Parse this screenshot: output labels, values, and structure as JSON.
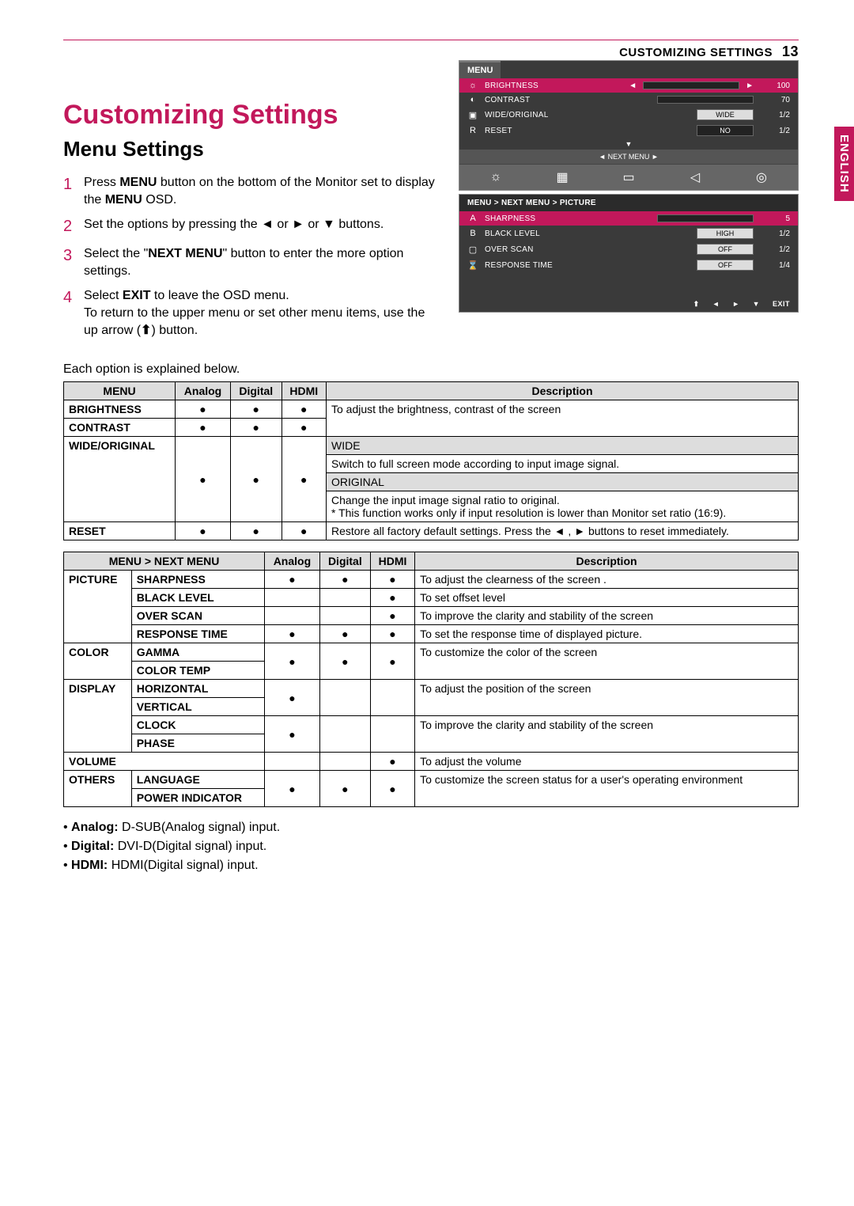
{
  "header": {
    "title": "CUSTOMIZING SETTINGS",
    "page": "13",
    "side_tab": "ENGLISH"
  },
  "h1": "Customizing Settings",
  "h2": "Menu Settings",
  "steps": {
    "s1a": "Press ",
    "s1b": "MENU",
    "s1c": " button on the bottom of the Monitor set to display the ",
    "s1d": "MENU",
    "s1e": " OSD.",
    "s2a": "Set the options by pressing the ",
    "s2b": "◄ or ► or ▼ ",
    "s2c": "buttons.",
    "s3a": "Select the \"",
    "s3b": "NEXT MENU",
    "s3c": "\" button to enter the more option settings.",
    "s4a": "Select ",
    "s4b": "EXIT",
    "s4c": " to leave the OSD menu.",
    "s4d": "To return to the upper menu or set other menu items, use the up arrow (",
    "s4e": ") button."
  },
  "osd1": {
    "tab": "MENU",
    "rows": [
      {
        "icn": "☼",
        "lbl": "BRIGHTNESS",
        "slider_pct": 100,
        "val": "100",
        "sel": true
      },
      {
        "icn": "◐",
        "lbl": "CONTRAST",
        "slider_pct": 70,
        "val": "70"
      },
      {
        "icn": "▣",
        "lbl": "WIDE/ORIGINAL",
        "pill": "WIDE",
        "pill_light": true,
        "val": "1/2"
      },
      {
        "icn": "R",
        "lbl": "RESET",
        "pill": "NO",
        "val": "1/2"
      }
    ],
    "nav": "◄   NEXT MENU   ►",
    "icons": [
      "☼",
      "▦",
      "▭",
      "◁",
      "◎"
    ]
  },
  "osd2": {
    "bc": "MENU  >  NEXT MENU  >  PICTURE",
    "rows": [
      {
        "icn": "A",
        "lbl": "SHARPNESS",
        "slider_pct": 10,
        "val": "5",
        "sel": true
      },
      {
        "icn": "B",
        "lbl": "BLACK LEVEL",
        "pill": "HIGH",
        "pill_light": true,
        "val": "1/2"
      },
      {
        "icn": "▢",
        "lbl": "OVER SCAN",
        "pill": "OFF",
        "pill_light": true,
        "val": "1/2"
      },
      {
        "icn": "⌛",
        "lbl": "RESPONSE TIME",
        "pill": "OFF",
        "pill_light": true,
        "val": "1/4"
      }
    ],
    "footer": [
      "⬆",
      "◄",
      "►",
      "▼",
      "EXIT"
    ]
  },
  "explain": "Each option is explained below.",
  "t1": {
    "h": [
      "MENU",
      "Analog",
      "Digital",
      "HDMI",
      "Description"
    ],
    "brightness": "BRIGHTNESS",
    "contrast": "CONTRAST",
    "desc_bc": "To adjust the brightness, contrast of the screen",
    "wide": "WIDE/ORIGINAL",
    "wide_h": "WIDE",
    "wide_d": "Switch to full screen mode according to input image signal.",
    "orig_h": "ORIGINAL",
    "orig_d": "Change the input image signal ratio to original.\n* This function works only if input resolution is lower than Monitor set ratio (16:9).",
    "reset": "RESET",
    "reset_d": "Restore all factory default settings. Press the ◄ ,  ►   buttons to reset immediately."
  },
  "t2": {
    "h": [
      "MENU > NEXT MENU",
      "Analog",
      "Digital",
      "HDMI",
      "Description"
    ],
    "picture": "PICTURE",
    "sharpness": "SHARPNESS",
    "sharpness_d": "To adjust the clearness of the screen .",
    "black": "BLACK LEVEL",
    "black_d": "To set offset level",
    "over": "OVER SCAN",
    "over_d": "To improve the clarity and stability of the screen",
    "resp": "RESPONSE TIME",
    "resp_d": "To set the response time of displayed picture.",
    "color": "COLOR",
    "gamma": "GAMMA",
    "ctemp": "COLOR TEMP",
    "color_d": "To customize the color of the screen",
    "display": "DISPLAY",
    "horiz": "HORIZONTAL",
    "vert": "VERTICAL",
    "pos_d": "To adjust the position of the screen",
    "clock": "CLOCK",
    "phase": "PHASE",
    "clk_d": "To improve the clarity and stability of the screen",
    "volume": "VOLUME",
    "vol_d": "To adjust the volume",
    "others": "OTHERS",
    "lang": "LANGUAGE",
    "pind": "POWER INDICATOR",
    "others_d": "To customize the screen status for a user's operating environment"
  },
  "bullets": {
    "a1": "Analog: ",
    "a2": "D-SUB(Analog signal) input.",
    "d1": "Digital: ",
    "d2": "DVI-D(Digital signal) input.",
    "h1": "HDMI: ",
    "h2": "HDMI(Digital signal) input."
  }
}
